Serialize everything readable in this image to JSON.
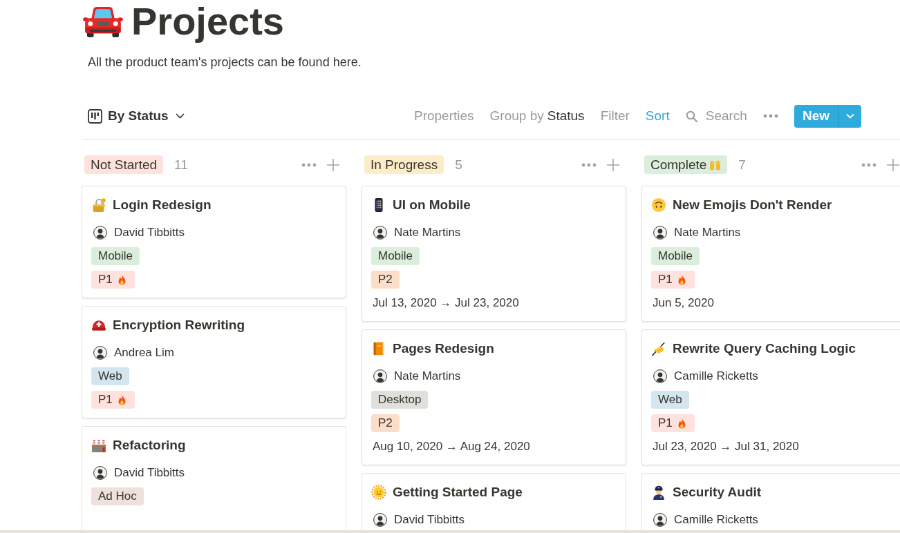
{
  "page": {
    "title": "Projects",
    "description": "All the product team's projects can be found here."
  },
  "view_bar": {
    "view": "By Status",
    "actions": [
      {
        "kind": "text",
        "label": "Properties",
        "active": false
      },
      {
        "kind": "text",
        "label": "Group by",
        "value": "Status",
        "active": false
      },
      {
        "kind": "text",
        "label": "Filter",
        "active": false
      },
      {
        "kind": "text",
        "label": "Sort",
        "active": true
      },
      {
        "kind": "search",
        "label": "Search",
        "active": false
      },
      {
        "kind": "more",
        "active": false
      }
    ],
    "new_button": "New"
  },
  "columns": [
    {
      "label": "Not Started",
      "color": "#ffe2dd",
      "count": "11",
      "cards": [
        {
          "title": "Login Redesign",
          "assignee": "David Tibbitts",
          "tags": [
            {
              "label": "Mobile",
              "color": "#dbeddb",
              "urgent": false
            },
            {
              "label": "P1",
              "color": "#ffe2dd",
              "urgent": true
            }
          ]
        },
        {
          "title": "Encryption Rewriting",
          "assignee": "Andrea Lim",
          "tags": [
            {
              "label": "Web",
              "color": "#d3e5ef",
              "urgent": false
            },
            {
              "label": "P1",
              "color": "#ffe2dd",
              "urgent": true
            }
          ]
        },
        {
          "title": "Refactoring",
          "assignee": "David Tibbitts",
          "tags": [
            {
              "label": "Ad Hoc",
              "color": "#eee0da",
              "urgent": false
            }
          ]
        }
      ]
    },
    {
      "label": "In Progress",
      "color": "#fdecc8",
      "count": "5",
      "cards": [
        {
          "title": "UI on Mobile",
          "assignee": "Nate Martins",
          "tags": [
            {
              "label": "Mobile",
              "color": "#dbeddb",
              "urgent": false
            },
            {
              "label": "P2",
              "color": "#fadec9",
              "urgent": false
            }
          ],
          "date": "Jul 13, 2020 → Jul 23, 2020"
        },
        {
          "title": "Pages Redesign",
          "assignee": "Nate Martins",
          "tags": [
            {
              "label": "Desktop",
              "color": "#e0dfdc",
              "urgent": false
            },
            {
              "label": "P2",
              "color": "#fadec9",
              "urgent": false
            }
          ],
          "date": "Aug 10, 2020 → Aug 24, 2020"
        },
        {
          "title": "Getting Started Page",
          "assignee": "David Tibbitts"
        }
      ]
    },
    {
      "label": "Complete",
      "color": "#dbeddb",
      "count": "7",
      "cards": [
        {
          "title": "New Emojis Don't Render",
          "assignee": "Nate Martins",
          "tags": [
            {
              "label": "Mobile",
              "color": "#dbeddb",
              "urgent": false
            },
            {
              "label": "P1",
              "color": "#ffe2dd",
              "urgent": true
            }
          ],
          "date": "Jun 5, 2020"
        },
        {
          "title": "Rewrite Query Caching Logic",
          "assignee": "Camille Ricketts",
          "tags": [
            {
              "label": "Web",
              "color": "#d3e5ef",
              "urgent": false
            },
            {
              "label": "P1",
              "color": "#ffe2dd",
              "urgent": true
            }
          ],
          "date": "Jul 23, 2020 → Jul 31, 2020"
        },
        {
          "title": "Security Audit",
          "assignee": "Camille Ricketts"
        }
      ]
    }
  ]
}
